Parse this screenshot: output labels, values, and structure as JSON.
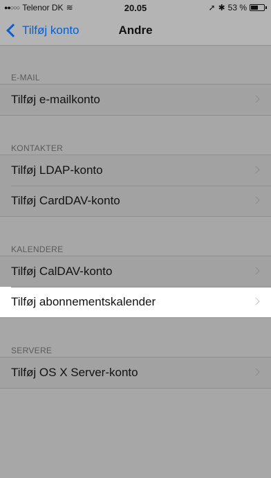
{
  "status_bar": {
    "signal_dots": "●●○○○",
    "carrier": "Telenor DK",
    "wifi_glyph": "≋",
    "time": "20.05",
    "location_glyph": "➚",
    "bluetooth_glyph": "✱",
    "battery_percent": "53 %",
    "battery_level": 0.53
  },
  "nav": {
    "back_label": "Tilføj konto",
    "title": "Andre"
  },
  "sections": {
    "email": {
      "header": "E-MAIL",
      "rows": [
        "Tilføj e-mailkonto"
      ]
    },
    "contacts": {
      "header": "KONTAKTER",
      "rows": [
        "Tilføj LDAP-konto",
        "Tilføj CardDAV-konto"
      ]
    },
    "calendars": {
      "header": "KALENDERE",
      "rows": [
        "Tilføj CalDAV-konto",
        "Tilføj abonnementskalender"
      ]
    },
    "servers": {
      "header": "SERVERE",
      "rows": [
        "Tilføj OS X Server-konto"
      ]
    }
  },
  "colors": {
    "accent": "#0a5fc9",
    "background": "#a7a7a7",
    "highlighted_row": "#ffffff"
  }
}
